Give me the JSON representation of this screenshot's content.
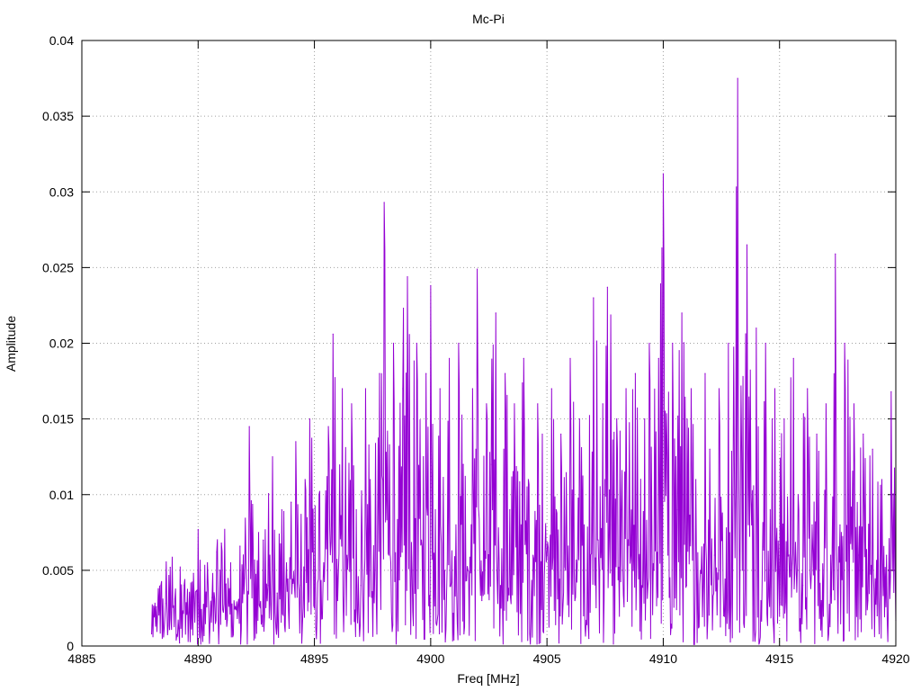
{
  "chart_data": {
    "type": "line",
    "title": "Mc-Pi",
    "xlabel": "Freq [MHz]",
    "ylabel": "Amplitude",
    "xlim": [
      4885,
      4920
    ],
    "ylim": [
      0,
      0.04
    ],
    "x_ticks": [
      4885,
      4890,
      4895,
      4900,
      4905,
      4910,
      4915,
      4920
    ],
    "y_ticks": [
      0,
      0.005,
      0.01,
      0.015,
      0.02,
      0.025,
      0.03,
      0.035,
      0.04
    ],
    "x_tick_labels": [
      "4885",
      "4890",
      "4895",
      "4900",
      "4905",
      "4910",
      "4915",
      "4920"
    ],
    "y_tick_labels": [
      "0",
      "0.005",
      "0.01",
      "0.015",
      "0.02",
      "0.025",
      "0.03",
      "0.035",
      "0.04"
    ],
    "grid": true,
    "series": [
      {
        "color": "#9400d3",
        "x_start": 4888.0,
        "x_end": 4920.0,
        "points": [
          [
            4888.0,
            0.0008
          ],
          [
            4888.2,
            0.0026
          ],
          [
            4888.4,
            0.004
          ],
          [
            4888.6,
            0.0028
          ],
          [
            4888.8,
            0.0052
          ],
          [
            4889.0,
            0.0031
          ],
          [
            4889.2,
            0.0002
          ],
          [
            4889.4,
            0.004
          ],
          [
            4889.6,
            0.0022
          ],
          [
            4889.8,
            0.0048
          ],
          [
            4890.0,
            0.0077
          ],
          [
            4890.2,
            0.0003
          ],
          [
            4890.4,
            0.0055
          ],
          [
            4890.6,
            0.0032
          ],
          [
            4890.8,
            0.0062
          ],
          [
            4891.0,
            0.0068
          ],
          [
            4891.2,
            0.0041
          ],
          [
            4891.4,
            0.0055
          ],
          [
            4891.6,
            0.0026
          ],
          [
            4891.8,
            0.0066
          ],
          [
            4892.0,
            0.0045
          ],
          [
            4892.2,
            0.0145
          ],
          [
            4892.4,
            0.0004
          ],
          [
            4892.6,
            0.0075
          ],
          [
            4892.8,
            0.007
          ],
          [
            4893.0,
            0.004
          ],
          [
            4893.2,
            0.0125
          ],
          [
            4893.4,
            0.0035
          ],
          [
            4893.6,
            0.009
          ],
          [
            4893.8,
            0.0055
          ],
          [
            4894.0,
            0.0095
          ],
          [
            4894.2,
            0.0135
          ],
          [
            4894.4,
            0.004
          ],
          [
            4894.6,
            0.011
          ],
          [
            4894.8,
            0.015
          ],
          [
            4895.0,
            0.0025
          ],
          [
            4895.2,
            0.01
          ],
          [
            4895.4,
            0.0055
          ],
          [
            4895.6,
            0.0145
          ],
          [
            4895.8,
            0.0206
          ],
          [
            4896.0,
            0.003
          ],
          [
            4896.2,
            0.017
          ],
          [
            4896.4,
            0.006
          ],
          [
            4896.6,
            0.016
          ],
          [
            4896.8,
            0.009
          ],
          [
            4897.0,
            0.004
          ],
          [
            4897.2,
            0.017
          ],
          [
            4897.4,
            0.011
          ],
          [
            4897.6,
            0.005
          ],
          [
            4897.8,
            0.018
          ],
          [
            4898.0,
            0.0293
          ],
          [
            4898.2,
            0.006
          ],
          [
            4898.4,
            0.02
          ],
          [
            4898.6,
            0.001
          ],
          [
            4898.8,
            0.017
          ],
          [
            4899.0,
            0.0244
          ],
          [
            4899.2,
            0.005
          ],
          [
            4899.4,
            0.02
          ],
          [
            4899.6,
            0.007
          ],
          [
            4899.8,
            0.018
          ],
          [
            4900.0,
            0.0238
          ],
          [
            4900.2,
            0.009
          ],
          [
            4900.4,
            0.017
          ],
          [
            4900.6,
            0.005
          ],
          [
            4900.8,
            0.019
          ],
          [
            4901.0,
            0.0004
          ],
          [
            4901.2,
            0.02
          ],
          [
            4901.4,
            0.012
          ],
          [
            4901.6,
            0.005
          ],
          [
            4901.8,
            0.017
          ],
          [
            4902.0,
            0.0249
          ],
          [
            4902.2,
            0.003
          ],
          [
            4902.4,
            0.016
          ],
          [
            4902.6,
            0.012
          ],
          [
            4902.8,
            0.022
          ],
          [
            4903.0,
            0.004
          ],
          [
            4903.2,
            0.018
          ],
          [
            4903.4,
            0.009
          ],
          [
            4903.6,
            0.016
          ],
          [
            4903.8,
            0.005
          ],
          [
            4904.0,
            0.019
          ],
          [
            4904.2,
            0.011
          ],
          [
            4904.4,
            0.006
          ],
          [
            4904.6,
            0.016
          ],
          [
            4904.8,
            0.014
          ],
          [
            4905.0,
            0.006
          ],
          [
            4905.2,
            0.017
          ],
          [
            4905.4,
            0.009
          ],
          [
            4905.6,
            0.014
          ],
          [
            4905.8,
            0.005
          ],
          [
            4906.0,
            0.019
          ],
          [
            4906.2,
            0.003
          ],
          [
            4906.4,
            0.015
          ],
          [
            4906.6,
            0.008
          ],
          [
            4906.8,
            0.0005
          ],
          [
            4907.0,
            0.023
          ],
          [
            4907.2,
            0.007
          ],
          [
            4907.4,
            0.016
          ],
          [
            4907.6,
            0.0237
          ],
          [
            4907.8,
            0.004
          ],
          [
            4908.0,
            0.015
          ],
          [
            4908.2,
            0.009
          ],
          [
            4908.4,
            0.017
          ],
          [
            4908.6,
            0.006
          ],
          [
            4908.8,
            0.018
          ],
          [
            4909.0,
            0.001
          ],
          [
            4909.2,
            0.015
          ],
          [
            4909.4,
            0.02
          ],
          [
            4909.6,
            0.005
          ],
          [
            4909.8,
            0.019
          ],
          [
            4910.0,
            0.0312
          ],
          [
            4910.2,
            0.006
          ],
          [
            4910.4,
            0.02
          ],
          [
            4910.6,
            0.009
          ],
          [
            4910.8,
            0.022
          ],
          [
            4911.0,
            0.004
          ],
          [
            4911.2,
            0.017
          ],
          [
            4911.4,
            0.011
          ],
          [
            4911.6,
            0.005
          ],
          [
            4911.8,
            0.018
          ],
          [
            4912.0,
            0.013
          ],
          [
            4912.2,
            0.006
          ],
          [
            4912.4,
            0.017
          ],
          [
            4912.6,
            0.002
          ],
          [
            4912.8,
            0.02
          ],
          [
            4913.0,
            0.01
          ],
          [
            4913.2,
            0.0375
          ],
          [
            4913.4,
            0.005
          ],
          [
            4913.6,
            0.0265
          ],
          [
            4913.8,
            0.008
          ],
          [
            4914.0,
            0.021
          ],
          [
            4914.2,
            0.003
          ],
          [
            4914.4,
            0.02
          ],
          [
            4914.6,
            0.009
          ],
          [
            4914.8,
            0.017
          ],
          [
            4915.0,
            0.002
          ],
          [
            4915.2,
            0.015
          ],
          [
            4915.4,
            0.006
          ],
          [
            4915.6,
            0.019
          ],
          [
            4915.8,
            0.01
          ],
          [
            4916.0,
            0.004
          ],
          [
            4916.2,
            0.017
          ],
          [
            4916.4,
            0.008
          ],
          [
            4916.6,
            0.014
          ],
          [
            4916.8,
            0.003
          ],
          [
            4917.0,
            0.016
          ],
          [
            4917.2,
            0.006
          ],
          [
            4917.4,
            0.0259
          ],
          [
            4917.6,
            0.008
          ],
          [
            4917.8,
            0.02
          ],
          [
            4918.0,
            0.001
          ],
          [
            4918.2,
            0.016
          ],
          [
            4918.4,
            0.006
          ],
          [
            4918.6,
            0.014
          ],
          [
            4918.8,
            0.003
          ],
          [
            4919.0,
            0.013
          ],
          [
            4919.2,
            0.002
          ],
          [
            4919.4,
            0.011
          ],
          [
            4919.6,
            0.006
          ],
          [
            4919.8,
            0.0168
          ],
          [
            4920.0,
            0.0017
          ]
        ]
      }
    ]
  }
}
